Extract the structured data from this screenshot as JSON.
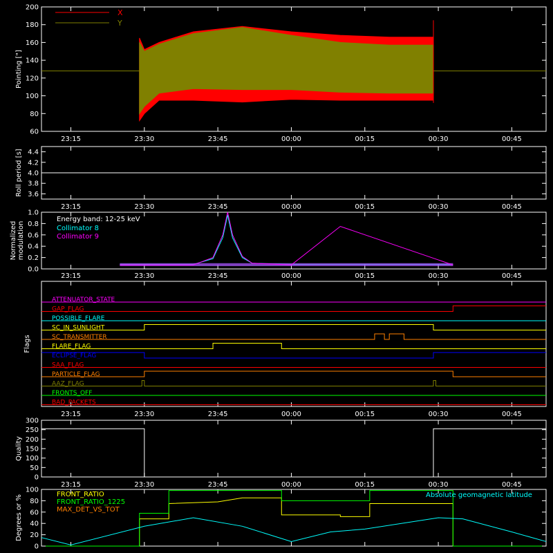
{
  "x_tick_labels": [
    "23:15",
    "23:30",
    "23:45",
    "00:00",
    "00:15",
    "00:30",
    "00:45"
  ],
  "chart_data": [
    {
      "type": "area",
      "ylabel": "Pointing [\"]",
      "ylim": [
        60,
        200
      ],
      "yticks": [
        60,
        80,
        100,
        120,
        140,
        160,
        180,
        200
      ],
      "legend": [
        {
          "name": "X",
          "color": "#ff0000"
        },
        {
          "name": "Y",
          "color": "#808000"
        }
      ],
      "series": [
        {
          "name": "X",
          "color": "#ff0000",
          "x": [
            "23:29",
            "23:30",
            "23:33",
            "23:40",
            "23:50",
            "00:00",
            "00:10",
            "00:20",
            "00:29"
          ],
          "upper": [
            165,
            152,
            160,
            172,
            178,
            172,
            168,
            166,
            166
          ],
          "lower": [
            72,
            80,
            95,
            95,
            93,
            96,
            95,
            95,
            95
          ]
        },
        {
          "name": "Y",
          "color": "#808000",
          "x": [
            "23:29",
            "23:30",
            "23:33",
            "23:40",
            "23:50",
            "00:00",
            "00:10",
            "00:20",
            "00:29"
          ],
          "upper": [
            160,
            150,
            158,
            170,
            177,
            168,
            160,
            157,
            157
          ],
          "lower": [
            80,
            88,
            103,
            108,
            107,
            107,
            104,
            103,
            103
          ]
        }
      ],
      "baseline": 128
    },
    {
      "type": "line",
      "ylabel": "Roll period [s]",
      "ylim": [
        3.5,
        4.5
      ],
      "yticks": [
        "3.6",
        "3.8",
        "4.0",
        "4.2",
        "4.4"
      ],
      "series": [
        {
          "color": "#ffffff",
          "x": [
            "23:09",
            "00:52"
          ],
          "y": [
            4.0,
            4.0
          ]
        }
      ]
    },
    {
      "type": "line",
      "ylabel": "Normalized modulation",
      "ylim": [
        0,
        1.0
      ],
      "yticks": [
        "0.0",
        "0.2",
        "0.4",
        "0.6",
        "0.8",
        "1.0"
      ],
      "annotation": "Energy band: 12-25 keV",
      "series": [
        {
          "name": "Collimator 8",
          "color": "#00ffff",
          "x": [
            "23:25",
            "23:40",
            "23:44",
            "23:46",
            "23:47",
            "23:48",
            "23:50",
            "23:52",
            "00:00",
            "00:10",
            "00:33"
          ],
          "y": [
            0.08,
            0.08,
            0.18,
            0.55,
            0.95,
            0.55,
            0.2,
            0.1,
            0.08,
            0.08,
            0.08
          ]
        },
        {
          "name": "Collimator 9",
          "color": "#ff00ff",
          "x": [
            "23:25",
            "23:40",
            "23:44",
            "23:46",
            "23:47",
            "23:48",
            "23:50",
            "23:52",
            "00:00",
            "00:10",
            "00:33"
          ],
          "y": [
            0.07,
            0.07,
            0.2,
            0.6,
            1.0,
            0.6,
            0.22,
            0.1,
            0.07,
            0.75,
            0.07
          ]
        }
      ]
    },
    {
      "type": "line",
      "ylabel": "Flags",
      "flags": [
        {
          "name": "ATTENUATOR_STATE",
          "color": "#ff00ff",
          "on": []
        },
        {
          "name": "GAP_FLAG",
          "color": "#ff0000",
          "on": [
            [
              "00:33",
              "00:52"
            ]
          ]
        },
        {
          "name": "POSSIBLE_FLARE",
          "color": "#00ffff",
          "on": []
        },
        {
          "name": "SC_IN_SUNLIGHT",
          "color": "#ffff00",
          "on": [
            [
              "23:30",
              "00:29"
            ]
          ]
        },
        {
          "name": "SC_TRANSMITTER",
          "color": "#ff8000",
          "on": [
            [
              "00:17",
              "00:19"
            ],
            [
              "00:20",
              "00:23"
            ]
          ]
        },
        {
          "name": "FLARE_FLAG",
          "color": "#ffff00",
          "on": [
            [
              "23:44",
              "23:58"
            ]
          ]
        },
        {
          "name": "ECLIPSE_FLAG",
          "color": "#0000ff",
          "on": [
            [
              "23:09",
              "23:30"
            ],
            [
              "00:29",
              "00:52"
            ]
          ]
        },
        {
          "name": "SAA_FLAG",
          "color": "#ff0000",
          "on": []
        },
        {
          "name": "PARTICLE_FLAG",
          "color": "#ff8000",
          "on": [
            [
              "23:30",
              "00:33"
            ]
          ]
        },
        {
          "name": "AAZ_FLAG",
          "color": "#808000",
          "on": [
            [
              "23:29.5",
              "23:30"
            ],
            [
              "00:29",
              "00:29.5"
            ]
          ]
        },
        {
          "name": "FRONTS_OFF",
          "color": "#00ff00",
          "on": []
        },
        {
          "name": "BAD_PACKETS",
          "color": "#ff0000",
          "on": []
        }
      ]
    },
    {
      "type": "line",
      "ylabel": "Quality",
      "ylim": [
        0,
        300
      ],
      "yticks": [
        0,
        50,
        100,
        150,
        200,
        250,
        300
      ],
      "series": [
        {
          "color": "#ffffff",
          "x": [
            "23:09",
            "23:30",
            "23:30",
            "00:29",
            "00:29",
            "00:52"
          ],
          "y": [
            255,
            255,
            0,
            0,
            255,
            255
          ]
        }
      ]
    },
    {
      "type": "line",
      "ylabel": "Degrees or %",
      "ylim": [
        0,
        100
      ],
      "yticks": [
        0,
        20,
        40,
        60,
        80,
        100
      ],
      "series": [
        {
          "name": "FRONT_RATIO",
          "color": "#ffff00",
          "x": [
            "23:09",
            "23:29",
            "23:29",
            "23:35",
            "23:35",
            "23:45",
            "23:50",
            "23:55",
            "23:58",
            "23:58",
            "00:10",
            "00:10",
            "00:16",
            "00:16",
            "00:25",
            "00:33",
            "00:33",
            "00:52"
          ],
          "y": [
            0,
            0,
            48,
            48,
            75,
            78,
            85,
            85,
            85,
            55,
            55,
            52,
            52,
            75,
            75,
            75,
            0,
            0
          ]
        },
        {
          "name": "FRONT_RATIO_1225",
          "color": "#00ff00",
          "x": [
            "23:09",
            "23:29",
            "23:29",
            "23:35",
            "23:35",
            "23:58",
            "23:58",
            "00:16",
            "00:16",
            "00:33",
            "00:33",
            "00:52"
          ],
          "y": [
            0,
            0,
            58,
            58,
            98,
            98,
            80,
            80,
            98,
            98,
            0,
            0
          ]
        },
        {
          "name": "MAX_DET_VS_TOT",
          "color": "#ff8000",
          "x": [],
          "y": []
        },
        {
          "name": "Absolute geomagnetic latitude",
          "color": "#00ffff",
          "x": [
            "23:09",
            "23:15",
            "23:30",
            "23:40",
            "23:50",
            "00:00",
            "00:08",
            "00:15",
            "00:30",
            "00:35",
            "00:45",
            "00:52"
          ],
          "y": [
            15,
            2,
            35,
            50,
            35,
            8,
            25,
            30,
            50,
            48,
            25,
            8
          ]
        }
      ]
    }
  ]
}
